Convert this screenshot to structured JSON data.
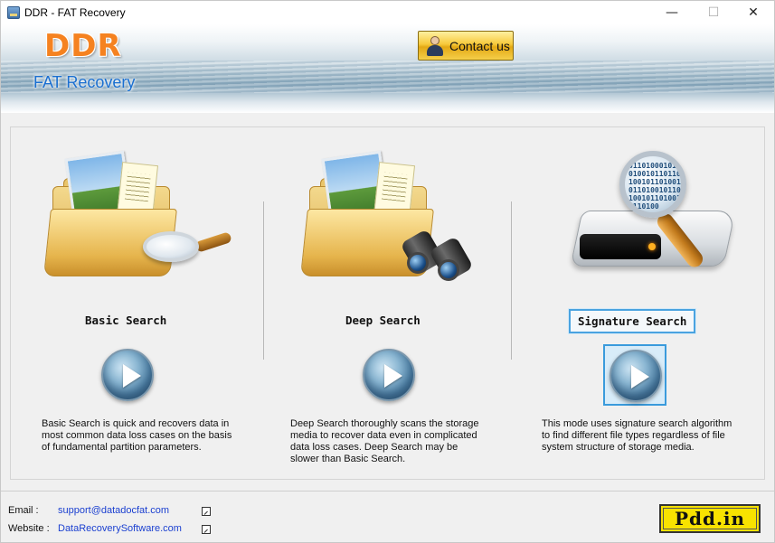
{
  "window": {
    "title": "DDR - FAT Recovery",
    "minimize": "—",
    "maximize": "☐",
    "close": "✕"
  },
  "header": {
    "logo": "DDR",
    "subtitle": "FAT Recovery",
    "contact_label": "Contact us"
  },
  "options": [
    {
      "label": "Basic Search",
      "description": "Basic Search is quick and recovers data in most common data loss cases on the basis of fundamental partition parameters."
    },
    {
      "label": "Deep Search",
      "description": "Deep Search thoroughly scans the storage media to recover data even in complicated data loss cases. Deep Search may be slower than Basic Search."
    },
    {
      "label": "Signature Search",
      "description": "This mode uses signature search algorithm to find different file types regardless of file system structure of storage media."
    }
  ],
  "binary_text": "0110100010110100101101101001011010010110100101101001011010010110100",
  "footer": {
    "email_label": "Email :",
    "email_value": "support@datadocfat.com",
    "website_label": "Website :",
    "website_value": "DataRecoverySoftware.com",
    "brand": "Pdd.in"
  },
  "colors": {
    "accent": "#3a9bdc",
    "logo": "#f58220",
    "subtitle": "#1a6fd0",
    "badge": "#f8e200"
  }
}
